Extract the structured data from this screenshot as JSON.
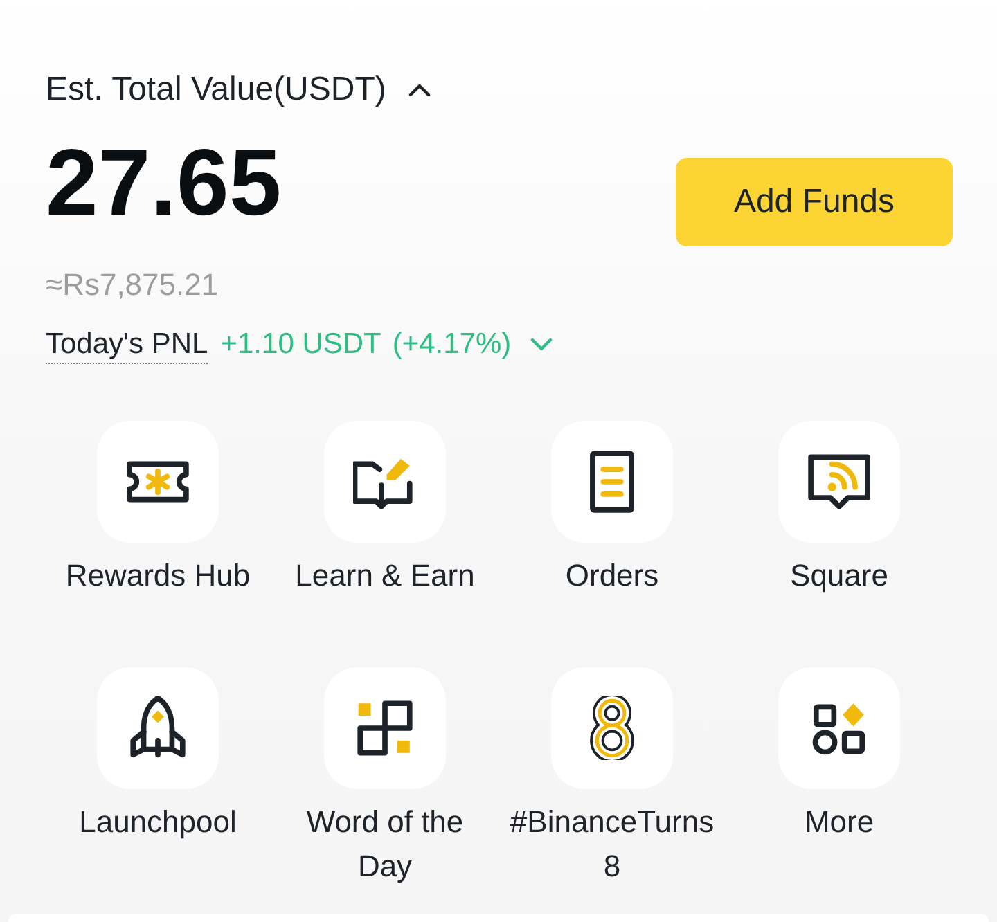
{
  "header": {
    "title": "Est. Total Value(USDT)",
    "expanded": true
  },
  "balance": {
    "value": "27.65",
    "fiat": "≈Rs7,875.21"
  },
  "add_funds_button": "Add Funds",
  "pnl": {
    "label": "Today's PNL",
    "value": "+1.10 USDT",
    "percent": "(+4.17%)",
    "expanded": false
  },
  "shortcuts": [
    {
      "label": "Rewards Hub",
      "kind": "ticket"
    },
    {
      "label": "Learn & Earn",
      "kind": "book"
    },
    {
      "label": "Orders",
      "kind": "document"
    },
    {
      "label": "Square",
      "kind": "feed"
    },
    {
      "label": "Launchpool",
      "kind": "rocket"
    },
    {
      "label": "Word of the Day",
      "kind": "tiles"
    },
    {
      "label": "#BinanceTurns 8",
      "kind": "eight"
    },
    {
      "label": "More",
      "kind": "shapes"
    }
  ]
}
